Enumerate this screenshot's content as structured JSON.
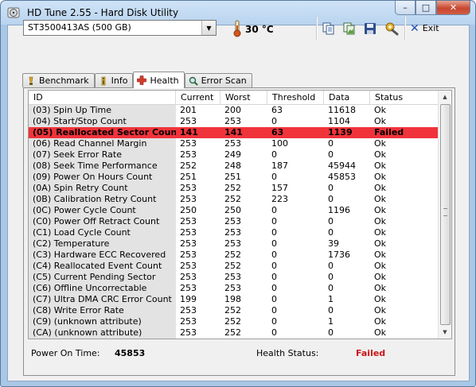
{
  "window": {
    "title": "HD Tune 2.55 - Hard Disk Utility",
    "minimize": "–",
    "maximize": "□",
    "close": "✕"
  },
  "toolbar": {
    "drive": "ST3500413AS (500 GB)",
    "temperature": "30 °C",
    "exit_label": "Exit"
  },
  "tabs": [
    {
      "label": "Benchmark",
      "icon": "gauge-icon"
    },
    {
      "label": "Info",
      "icon": "info-icon"
    },
    {
      "label": "Health",
      "icon": "health-cross-icon",
      "active": true
    },
    {
      "label": "Error Scan",
      "icon": "magnifier-icon"
    }
  ],
  "table": {
    "columns": [
      "ID",
      "Current",
      "Worst",
      "Threshold",
      "Data",
      "Status"
    ],
    "rows": [
      [
        "(03) Spin Up Time",
        "201",
        "200",
        "63",
        "11618",
        "Ok"
      ],
      [
        "(04) Start/Stop Count",
        "253",
        "253",
        "0",
        "1104",
        "Ok"
      ],
      [
        "(05) Reallocated Sector Count",
        "141",
        "141",
        "63",
        "1139",
        "Failed"
      ],
      [
        "(06) Read Channel Margin",
        "253",
        "253",
        "100",
        "0",
        "Ok"
      ],
      [
        "(07) Seek Error Rate",
        "253",
        "249",
        "0",
        "0",
        "Ok"
      ],
      [
        "(08) Seek Time Performance",
        "252",
        "248",
        "187",
        "45944",
        "Ok"
      ],
      [
        "(09) Power On Hours Count",
        "251",
        "251",
        "0",
        "45853",
        "Ok"
      ],
      [
        "(0A) Spin Retry Count",
        "253",
        "252",
        "157",
        "0",
        "Ok"
      ],
      [
        "(0B) Calibration Retry Count",
        "253",
        "252",
        "223",
        "0",
        "Ok"
      ],
      [
        "(0C) Power Cycle Count",
        "250",
        "250",
        "0",
        "1196",
        "Ok"
      ],
      [
        "(C0) Power Off Retract Count",
        "253",
        "253",
        "0",
        "0",
        "Ok"
      ],
      [
        "(C1) Load Cycle Count",
        "253",
        "253",
        "0",
        "0",
        "Ok"
      ],
      [
        "(C2) Temperature",
        "253",
        "253",
        "0",
        "39",
        "Ok"
      ],
      [
        "(C3) Hardware ECC Recovered",
        "253",
        "252",
        "0",
        "1736",
        "Ok"
      ],
      [
        "(C4) Reallocated Event Count",
        "253",
        "252",
        "0",
        "0",
        "Ok"
      ],
      [
        "(C5) Current Pending Sector",
        "253",
        "253",
        "0",
        "0",
        "Ok"
      ],
      [
        "(C6) Offline Uncorrectable",
        "253",
        "253",
        "0",
        "0",
        "Ok"
      ],
      [
        "(C7) Ultra DMA CRC Error Count",
        "199",
        "198",
        "0",
        "1",
        "Ok"
      ],
      [
        "(C8) Write Error Rate",
        "253",
        "252",
        "0",
        "0",
        "Ok"
      ],
      [
        "(C9) (unknown attribute)",
        "253",
        "252",
        "0",
        "1",
        "Ok"
      ],
      [
        "(CA) (unknown attribute)",
        "253",
        "252",
        "0",
        "0",
        "Ok"
      ]
    ],
    "failed_row_color": "#f0333b"
  },
  "status": {
    "power_on_label": "Power On Time:",
    "power_on_value": "45853",
    "health_label": "Health Status:",
    "health_value": "Failed"
  }
}
